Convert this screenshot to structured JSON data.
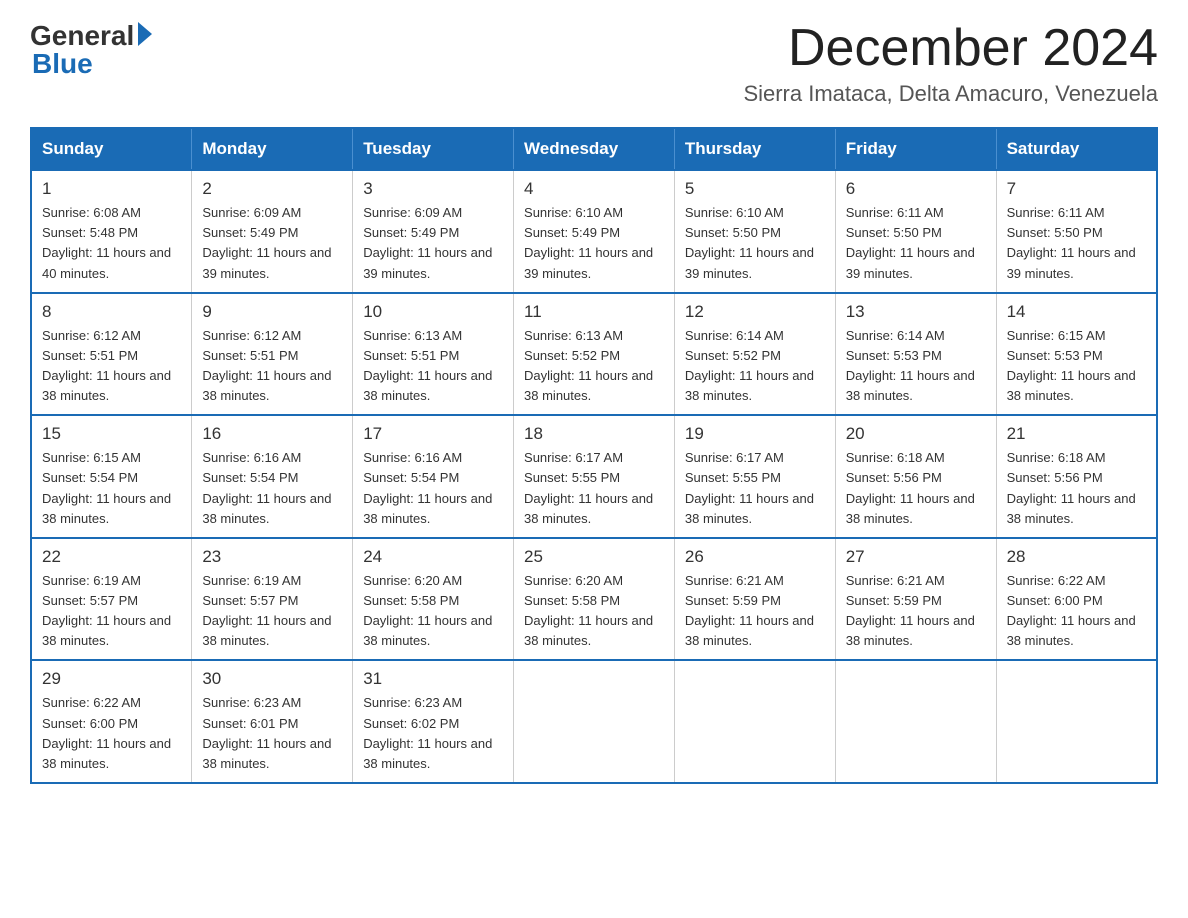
{
  "logo": {
    "general": "General",
    "blue": "Blue"
  },
  "title": {
    "month_year": "December 2024",
    "location": "Sierra Imataca, Delta Amacuro, Venezuela"
  },
  "header_days": [
    "Sunday",
    "Monday",
    "Tuesday",
    "Wednesday",
    "Thursday",
    "Friday",
    "Saturday"
  ],
  "weeks": [
    [
      {
        "day": "1",
        "sunrise": "6:08 AM",
        "sunset": "5:48 PM",
        "daylight": "11 hours and 40 minutes."
      },
      {
        "day": "2",
        "sunrise": "6:09 AM",
        "sunset": "5:49 PM",
        "daylight": "11 hours and 39 minutes."
      },
      {
        "day": "3",
        "sunrise": "6:09 AM",
        "sunset": "5:49 PM",
        "daylight": "11 hours and 39 minutes."
      },
      {
        "day": "4",
        "sunrise": "6:10 AM",
        "sunset": "5:49 PM",
        "daylight": "11 hours and 39 minutes."
      },
      {
        "day": "5",
        "sunrise": "6:10 AM",
        "sunset": "5:50 PM",
        "daylight": "11 hours and 39 minutes."
      },
      {
        "day": "6",
        "sunrise": "6:11 AM",
        "sunset": "5:50 PM",
        "daylight": "11 hours and 39 minutes."
      },
      {
        "day": "7",
        "sunrise": "6:11 AM",
        "sunset": "5:50 PM",
        "daylight": "11 hours and 39 minutes."
      }
    ],
    [
      {
        "day": "8",
        "sunrise": "6:12 AM",
        "sunset": "5:51 PM",
        "daylight": "11 hours and 38 minutes."
      },
      {
        "day": "9",
        "sunrise": "6:12 AM",
        "sunset": "5:51 PM",
        "daylight": "11 hours and 38 minutes."
      },
      {
        "day": "10",
        "sunrise": "6:13 AM",
        "sunset": "5:51 PM",
        "daylight": "11 hours and 38 minutes."
      },
      {
        "day": "11",
        "sunrise": "6:13 AM",
        "sunset": "5:52 PM",
        "daylight": "11 hours and 38 minutes."
      },
      {
        "day": "12",
        "sunrise": "6:14 AM",
        "sunset": "5:52 PM",
        "daylight": "11 hours and 38 minutes."
      },
      {
        "day": "13",
        "sunrise": "6:14 AM",
        "sunset": "5:53 PM",
        "daylight": "11 hours and 38 minutes."
      },
      {
        "day": "14",
        "sunrise": "6:15 AM",
        "sunset": "5:53 PM",
        "daylight": "11 hours and 38 minutes."
      }
    ],
    [
      {
        "day": "15",
        "sunrise": "6:15 AM",
        "sunset": "5:54 PM",
        "daylight": "11 hours and 38 minutes."
      },
      {
        "day": "16",
        "sunrise": "6:16 AM",
        "sunset": "5:54 PM",
        "daylight": "11 hours and 38 minutes."
      },
      {
        "day": "17",
        "sunrise": "6:16 AM",
        "sunset": "5:54 PM",
        "daylight": "11 hours and 38 minutes."
      },
      {
        "day": "18",
        "sunrise": "6:17 AM",
        "sunset": "5:55 PM",
        "daylight": "11 hours and 38 minutes."
      },
      {
        "day": "19",
        "sunrise": "6:17 AM",
        "sunset": "5:55 PM",
        "daylight": "11 hours and 38 minutes."
      },
      {
        "day": "20",
        "sunrise": "6:18 AM",
        "sunset": "5:56 PM",
        "daylight": "11 hours and 38 minutes."
      },
      {
        "day": "21",
        "sunrise": "6:18 AM",
        "sunset": "5:56 PM",
        "daylight": "11 hours and 38 minutes."
      }
    ],
    [
      {
        "day": "22",
        "sunrise": "6:19 AM",
        "sunset": "5:57 PM",
        "daylight": "11 hours and 38 minutes."
      },
      {
        "day": "23",
        "sunrise": "6:19 AM",
        "sunset": "5:57 PM",
        "daylight": "11 hours and 38 minutes."
      },
      {
        "day": "24",
        "sunrise": "6:20 AM",
        "sunset": "5:58 PM",
        "daylight": "11 hours and 38 minutes."
      },
      {
        "day": "25",
        "sunrise": "6:20 AM",
        "sunset": "5:58 PM",
        "daylight": "11 hours and 38 minutes."
      },
      {
        "day": "26",
        "sunrise": "6:21 AM",
        "sunset": "5:59 PM",
        "daylight": "11 hours and 38 minutes."
      },
      {
        "day": "27",
        "sunrise": "6:21 AM",
        "sunset": "5:59 PM",
        "daylight": "11 hours and 38 minutes."
      },
      {
        "day": "28",
        "sunrise": "6:22 AM",
        "sunset": "6:00 PM",
        "daylight": "11 hours and 38 minutes."
      }
    ],
    [
      {
        "day": "29",
        "sunrise": "6:22 AM",
        "sunset": "6:00 PM",
        "daylight": "11 hours and 38 minutes."
      },
      {
        "day": "30",
        "sunrise": "6:23 AM",
        "sunset": "6:01 PM",
        "daylight": "11 hours and 38 minutes."
      },
      {
        "day": "31",
        "sunrise": "6:23 AM",
        "sunset": "6:02 PM",
        "daylight": "11 hours and 38 minutes."
      },
      {
        "day": "",
        "sunrise": "",
        "sunset": "",
        "daylight": ""
      },
      {
        "day": "",
        "sunrise": "",
        "sunset": "",
        "daylight": ""
      },
      {
        "day": "",
        "sunrise": "",
        "sunset": "",
        "daylight": ""
      },
      {
        "day": "",
        "sunrise": "",
        "sunset": "",
        "daylight": ""
      }
    ]
  ]
}
